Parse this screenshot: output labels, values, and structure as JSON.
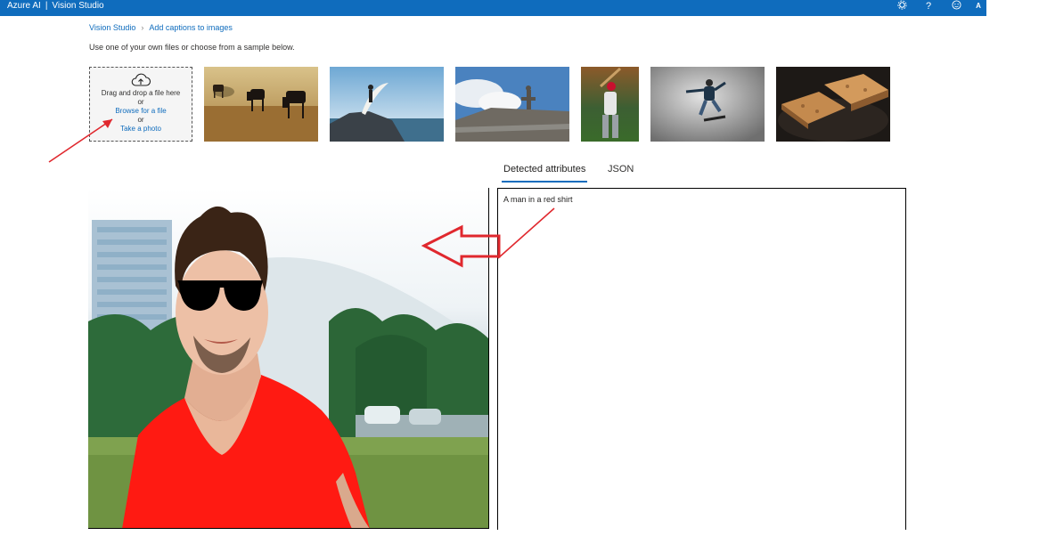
{
  "app": {
    "brand": "Azure AI",
    "separator": "|",
    "product": "Vision Studio",
    "header_icons": [
      "settings-icon",
      "help-icon",
      "feedback-icon",
      "account-avatar"
    ],
    "avatar_initial": "A"
  },
  "breadcrumb": {
    "root": "Vision Studio",
    "current": "Add captions to images"
  },
  "instruction": "Use one of your own files or choose from a sample below.",
  "upload": {
    "drag_text": "Drag and drop a file here",
    "or1": "or",
    "browse": "Browse for a file",
    "or2": "or",
    "photo": "Take a photo"
  },
  "samples": [
    "cows grazing in a field",
    "surfer on rocky shore",
    "statues on building roof",
    "baseball batter",
    "skateboarder mid-jump",
    "grilled sandwiches"
  ],
  "tabs": {
    "detected": "Detected attributes",
    "json": "JSON"
  },
  "result": {
    "caption": "A man in a red shirt"
  },
  "colors": {
    "accent": "#0f6cbd",
    "annotation_red": "#e0282e"
  }
}
